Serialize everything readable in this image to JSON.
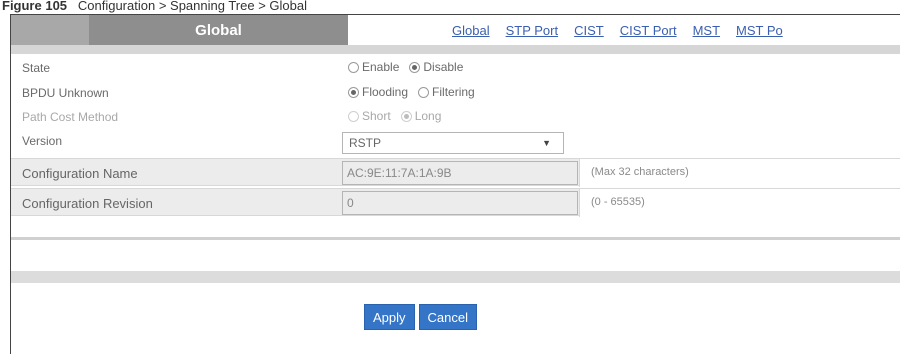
{
  "caption": {
    "figure_label": "Figure 105",
    "text": "Configuration > Spanning Tree > Global"
  },
  "header": {
    "active_tab": "Global",
    "links": [
      "Global",
      "STP Port",
      "CIST",
      "CIST Port",
      "MST",
      "MST Po"
    ]
  },
  "form": {
    "state": {
      "label": "State",
      "options": [
        "Enable",
        "Disable"
      ],
      "selected": "Disable"
    },
    "bpdu_unknown": {
      "label": "BPDU Unknown",
      "options": [
        "Flooding",
        "Filtering"
      ],
      "selected": "Flooding"
    },
    "path_cost_method": {
      "label": "Path Cost Method",
      "options": [
        "Short",
        "Long"
      ],
      "selected": "Long"
    },
    "version": {
      "label": "Version",
      "value": "RSTP"
    },
    "configuration_name": {
      "label": "Configuration Name",
      "value": "AC:9E:11:7A:1A:9B",
      "hint": "(Max 32 characters)"
    },
    "configuration_revision": {
      "label": "Configuration Revision",
      "value": "0",
      "hint": "(0 - 65535)"
    }
  },
  "actions": {
    "apply": "Apply",
    "cancel": "Cancel"
  }
}
